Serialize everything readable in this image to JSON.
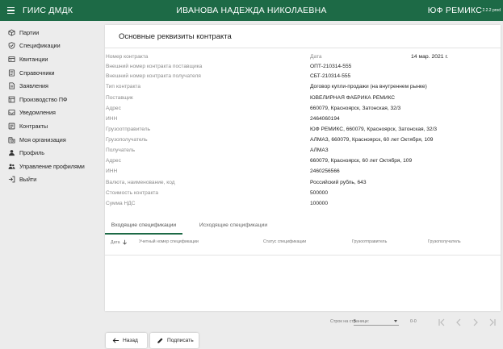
{
  "header": {
    "app_title": "ГИИС ДМДК",
    "user_name": "ИВАНОВА НАДЕЖДА НИКОЛАЕВНА",
    "org_name": "ЮФ РЕМИКС",
    "version": "2.2.2 prod"
  },
  "sidebar": {
    "items": [
      {
        "label": "Партии",
        "icon": "box-icon"
      },
      {
        "label": "Спецификации",
        "icon": "shield-check-icon"
      },
      {
        "label": "Квитанции",
        "icon": "receipt-icon"
      },
      {
        "label": "Справочники",
        "icon": "book-icon"
      },
      {
        "label": "Заявления",
        "icon": "document-icon"
      },
      {
        "label": "Производство ПФ",
        "icon": "factory-icon"
      },
      {
        "label": "Уведомления",
        "icon": "notification-icon"
      },
      {
        "label": "Контракты",
        "icon": "contract-icon"
      },
      {
        "label": "Моя организация",
        "icon": "building-icon"
      },
      {
        "label": "Профиль",
        "icon": "person-icon"
      },
      {
        "label": "Управление профилями",
        "icon": "people-icon"
      },
      {
        "label": "Выйти",
        "icon": "logout-icon"
      }
    ]
  },
  "contract": {
    "title": "Основные реквизиты контракта",
    "left_labels": [
      "Номер контракта",
      "Внешний номер контракта поставщика",
      "Внешний номер контракта получателя",
      "Тип контракта",
      "Поставщик",
      "Адрес",
      "ИНН",
      "Грузоотправитель",
      "Грузополучатель",
      "Получатель",
      "Адрес",
      "ИНН",
      "Валюта, наименование, код",
      "Стоимость контракта",
      "Сумма НДС"
    ],
    "right_values": [
      "Дата",
      "ОПТ-210314-555",
      "СБТ-210314-555",
      "Договор купли-продажи (на внутреннем рынке)",
      "ЮВЕЛИРНАЯ ФАБРИКА РЕМИКС",
      "660079, Красноярск, Затонская, 32/3",
      "2464060194",
      "ЮФ РЕМИКС, 660079, Красноярск, Затонская, 32/3",
      "АЛМАЗ, 660079, Красноярск, 60 лет Октября, 109",
      "АЛМАЗ",
      "660079, Красноярск, 60 лет Октября, 109",
      "2460256566",
      "Российский рубль, 643",
      "500000",
      "100000"
    ],
    "date_value": "14 мар. 2021 г."
  },
  "tabs": {
    "incoming": "Входящие спецификации",
    "outgoing": "Исходящие спецификации"
  },
  "table": {
    "columns": [
      "Дата",
      "Учетный номер спецификации",
      "Статус спецификации",
      "Грузоотправитель",
      "Грузополучатель"
    ]
  },
  "pager": {
    "rows_label": "Строк на странице:",
    "rows_value": "5",
    "range": "0-0"
  },
  "actions": {
    "back": "Назад",
    "sign": "Подписать"
  },
  "colors": {
    "brand": "#1d6a46"
  }
}
